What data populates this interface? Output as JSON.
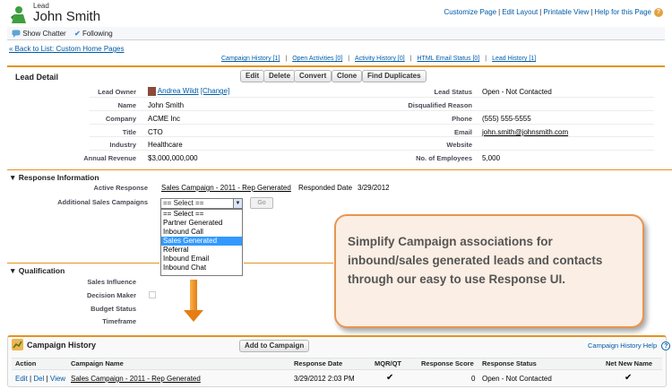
{
  "header": {
    "object_type": "Lead",
    "record_name": "John Smith",
    "top_links": [
      "Customize Page",
      "Edit Layout",
      "Printable View",
      "Help for this Page"
    ],
    "help_glyph": "?"
  },
  "chatter": {
    "show_chatter": "Show Chatter",
    "following": "Following"
  },
  "back_link": "« Back to List: Custom Home Pages",
  "related_links": [
    "Campaign History [1]",
    "Open Activities [0]",
    "Activity History [0]",
    "HTML Email Status [0]",
    "Lead History [1]"
  ],
  "lead_detail": {
    "title": "Lead Detail",
    "buttons": [
      "Edit",
      "Delete",
      "Convert",
      "Clone",
      "Find Duplicates"
    ],
    "left_fields": [
      {
        "label": "Lead Owner",
        "value": "Andrea Wildt",
        "extra": "[Change]"
      },
      {
        "label": "Name",
        "value": "John Smith"
      },
      {
        "label": "Company",
        "value": "ACME Inc"
      },
      {
        "label": "Title",
        "value": "CTO"
      },
      {
        "label": "Industry",
        "value": "Healthcare"
      },
      {
        "label": "Annual Revenue",
        "value": "$3,000,000,000"
      }
    ],
    "right_fields": [
      {
        "label": "Lead Status",
        "value": "Open - Not Contacted"
      },
      {
        "label": "Disqualified Reason",
        "value": ""
      },
      {
        "label": "Phone",
        "value": "(555) 555-5555"
      },
      {
        "label": "Email",
        "value": "john.smith@johnsmith.com"
      },
      {
        "label": "Website",
        "value": ""
      },
      {
        "label": "No. of Employees",
        "value": "5,000"
      }
    ]
  },
  "response_info": {
    "title": "Response Information",
    "active_response_label": "Active Response",
    "active_response_value": "Sales Campaign - 2011 - Rep Generated",
    "responded_date_label": "Responded Date",
    "responded_date_value": "3/29/2012",
    "additional_label": "Additional Sales Campaigns",
    "select_value": "== Select ==",
    "go_label": "Go",
    "options": [
      "== Select ==",
      "Partner Generated",
      "Inbound Call",
      "Sales Generated",
      "Referral",
      "Inbound Email",
      "Inbound Chat"
    ],
    "highlighted_option": "Sales Generated"
  },
  "qualification": {
    "title": "Qualification",
    "fields": [
      "Sales Influence",
      "Decision Maker",
      "Budget Status",
      "Timeframe"
    ]
  },
  "callout": {
    "text": "Simplify Campaign associations for inbound/sales generated leads and contacts through our easy to use Response UI."
  },
  "campaign_history": {
    "title": "Campaign History",
    "add_button": "Add to Campaign",
    "help_link": "Campaign History Help",
    "columns": [
      "Action",
      "Campaign Name",
      "Response Date",
      "MQR/QT",
      "Response Score",
      "Response Status",
      "Net New Name"
    ],
    "row": {
      "actions": [
        "Edit",
        "Del",
        "View"
      ],
      "campaign_name": "Sales Campaign - 2011 - Rep Generated",
      "response_date": "3/29/2012 2:03 PM",
      "mqr_qt": "✔",
      "response_score": "0",
      "response_status": "Open - Not Contacted",
      "net_new_name": "✔"
    }
  },
  "colors": {
    "accent": "#e39321",
    "link": "#015ba7",
    "callout_bg": "#fbeee4",
    "callout_border": "#e8954f",
    "selected_option": "#3399ff"
  },
  "icons": [
    "lead-person-icon",
    "chatter-icon",
    "follow-check-icon",
    "owner-avatar-icon",
    "help-icon",
    "arrow-down-icon",
    "campaign-history-icon",
    "collapse-triangle-icon"
  ]
}
